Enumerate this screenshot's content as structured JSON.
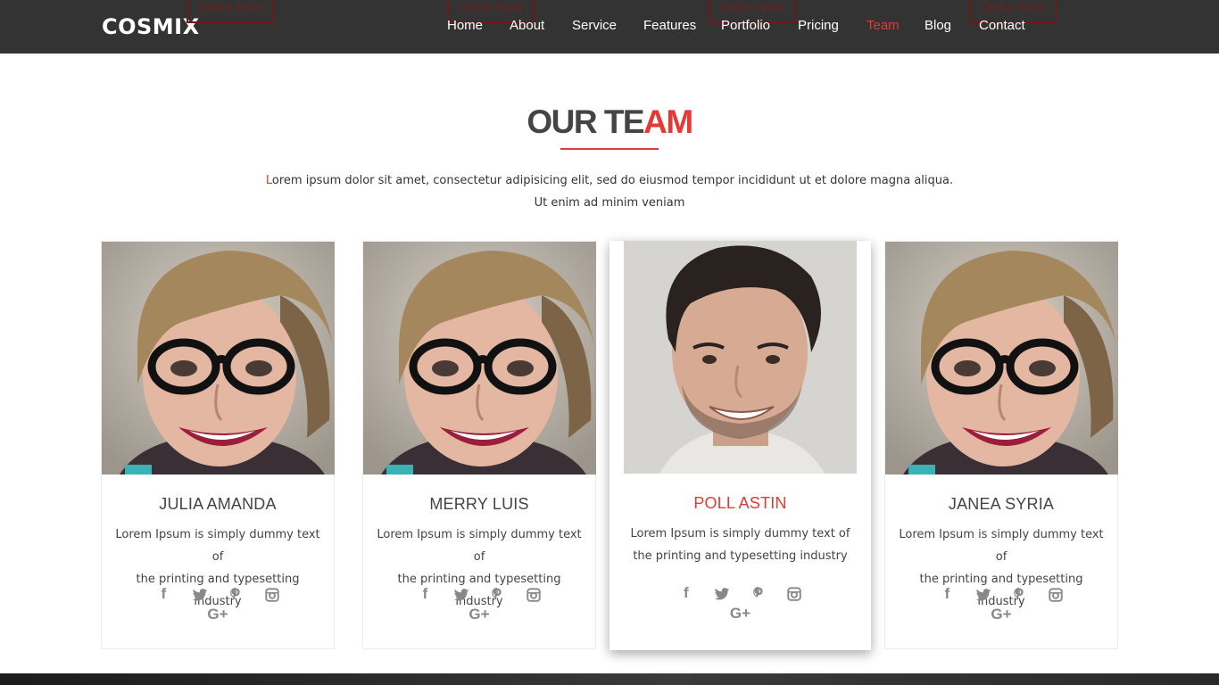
{
  "header": {
    "logo": "COSMIX",
    "order_label": "Order Now",
    "nav": [
      {
        "label": "Home"
      },
      {
        "label": "About"
      },
      {
        "label": "Service"
      },
      {
        "label": "Features"
      },
      {
        "label": "Portfolio"
      },
      {
        "label": "Pricing"
      },
      {
        "label": "Team",
        "active": true
      },
      {
        "label": "Blog"
      },
      {
        "label": "Contact"
      }
    ]
  },
  "section": {
    "title_part1": "OUR TE",
    "title_part2": "AM",
    "intro_first": "L",
    "intro_rest": "orem ipsum dolor sit amet, consectetur adipisicing elit, sed do eiusmod tempor incididunt ut et dolore magna aliqua.",
    "intro_line2": "Ut enim ad minim veniam"
  },
  "team": [
    {
      "name": "JULIA AMANDA",
      "desc_line1": "Lorem Ipsum is simply dummy text of",
      "desc_line2": "the printing and typesetting industry",
      "photo": "woman-glasses"
    },
    {
      "name": "MERRY LUIS",
      "desc_line1": "Lorem Ipsum is simply dummy text of",
      "desc_line2": "the printing and typesetting industry",
      "photo": "woman-glasses"
    },
    {
      "name": "POLL ASTIN",
      "desc_line1": "Lorem Ipsum is simply dummy text of",
      "desc_line2": "the printing and typesetting industry",
      "photo": "man-smiling",
      "featured": true
    },
    {
      "name": "JANEA SYRIA",
      "desc_line1": "Lorem Ipsum is simply dummy text of",
      "desc_line2": "the printing and typesetting industry",
      "photo": "woman-glasses"
    }
  ],
  "social_icons": [
    "facebook-icon",
    "twitter-icon",
    "pinterest-icon",
    "instagram-icon",
    "google-plus-icon"
  ],
  "colors": {
    "accent": "#e53935",
    "header_bg": "#333333",
    "text": "#444444",
    "icon": "#888888"
  }
}
